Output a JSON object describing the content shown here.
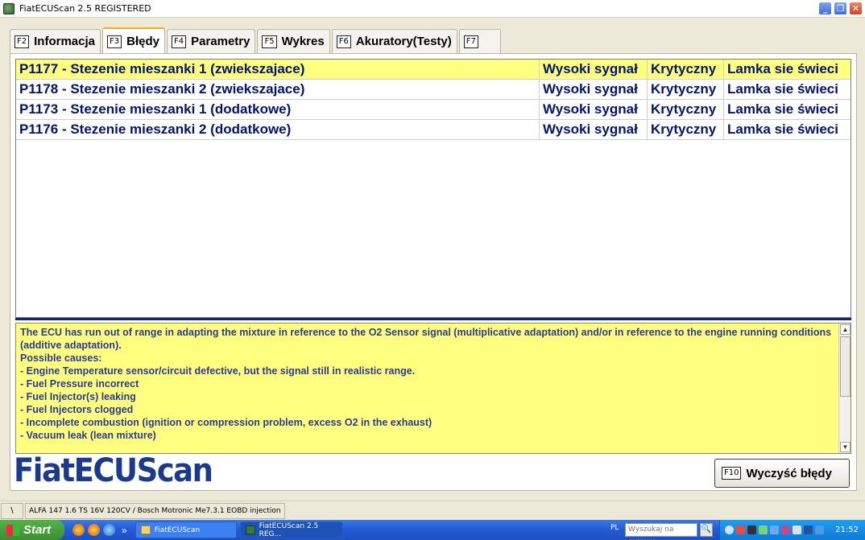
{
  "window": {
    "title": "FiatECUScan 2.5 REGISTERED",
    "minimize_label": "_",
    "restore_label": "❐",
    "close_label": "✕"
  },
  "tabs": [
    {
      "key": "F2",
      "label": "Informacja"
    },
    {
      "key": "F3",
      "label": "Błędy"
    },
    {
      "key": "F4",
      "label": "Parametry"
    },
    {
      "key": "F5",
      "label": "Wykres"
    },
    {
      "key": "F6",
      "label": "Akuratory(Testy)"
    },
    {
      "key": "F7",
      "label": ""
    }
  ],
  "faults": [
    {
      "code": "P1177 - Stezenie mieszanki 1 (zwiekszajace)",
      "signal": "Wysoki sygnał",
      "severity": "Krytyczny",
      "lamp": "Lamka sie świeci"
    },
    {
      "code": "P1178 - Stezenie mieszanki 2 (zwiekszajace)",
      "signal": "Wysoki sygnał",
      "severity": "Krytyczny",
      "lamp": "Lamka sie świeci"
    },
    {
      "code": "P1173 - Stezenie mieszanki 1 (dodatkowe)",
      "signal": "Wysoki sygnał",
      "severity": "Krytyczny",
      "lamp": "Lamka sie świeci"
    },
    {
      "code": "P1176 - Stezenie mieszanki 2 (dodatkowe)",
      "signal": "Wysoki sygnał",
      "severity": "Krytyczny",
      "lamp": "Lamka sie świeci"
    }
  ],
  "description": "The ECU has run out of range in adapting the mixture in reference to the O2 Sensor signal (multiplicative adaptation) and/or in reference to the engine running conditions (additive adaptation).\nPossible causes:\n- Engine Temperature sensor/circuit defective, but the signal still in realistic range.\n- Fuel Pressure incorrect\n- Fuel Injector(s) leaking\n- Fuel Injectors clogged\n- Incomplete combustion (ignition or compression problem, excess O2 in the exhaust)\n- Vacuum leak (lean mixture)",
  "logo": "FiatECUScan",
  "clear_button": {
    "key": "F10",
    "label": "Wyczyść błędy"
  },
  "status": {
    "left": "\\",
    "vehicle": "ALFA 147 1.6 TS 16V 120CV / Bosch Motronic Me7.3.1 EOBD injection"
  },
  "taskbar": {
    "start_label": "Start",
    "more": "»",
    "tasks": [
      {
        "label": "FiatECUScan"
      },
      {
        "label": "FiatECUScan 2.5 REG..."
      }
    ],
    "lang": "PL",
    "search_placeholder": "Wyszukaj na pulpicie",
    "search_button": "🔍",
    "clock": "21:52"
  }
}
